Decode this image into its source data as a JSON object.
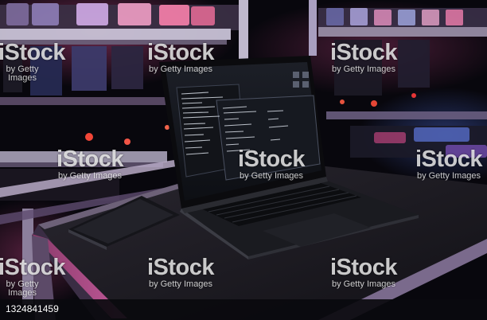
{
  "watermark": {
    "brand": "iStock",
    "sub": "by Getty Images"
  },
  "credit": {
    "id": "1324841459"
  },
  "colors": {
    "background": "#07060c",
    "accent_pink": "#d94a8c",
    "accent_blue": "#4b6fd8",
    "accent_red": "#e0382e"
  }
}
